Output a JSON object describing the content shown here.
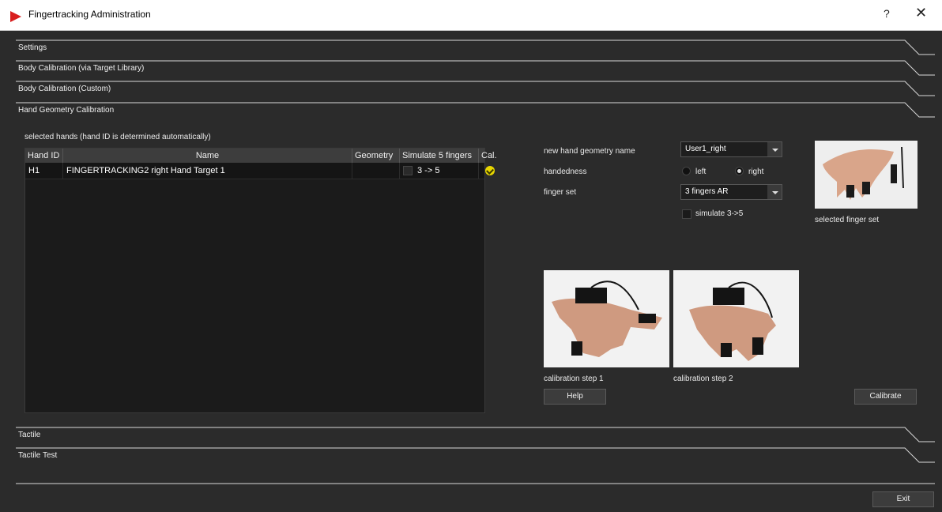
{
  "window": {
    "title": "Fingertracking Administration",
    "help_label": "?",
    "close_label": "✕"
  },
  "sections": {
    "settings": "Settings",
    "body_target": "Body Calibration (via Target Library)",
    "body_custom": "Body Calibration (Custom)",
    "hand_geometry": "Hand Geometry Calibration",
    "tactile": "Tactile",
    "tactile_test": "Tactile Test"
  },
  "hands": {
    "caption": "selected hands (hand ID is determined automatically)",
    "columns": [
      "Hand ID",
      "Name",
      "Geometry",
      "Simulate 5 fingers",
      "Cal."
    ],
    "rows": [
      {
        "hand_id": "H1",
        "name": "FINGERTRACKING2 right Hand Target 1",
        "geometry": "",
        "simulate": "3 -> 5",
        "calibrated": true
      }
    ]
  },
  "form": {
    "geometry_name_label": "new hand geometry name",
    "geometry_name_value": "User1_right",
    "handedness_label": "handedness",
    "left_label": "left",
    "right_label": "right",
    "handedness_selected": "right",
    "finger_set_label": "finger set",
    "finger_set_value": "3 fingers AR",
    "simulate_label": "simulate 3->5",
    "simulate_checked": false
  },
  "images": {
    "finger_set_caption": "selected finger set",
    "step1_caption": "calibration step 1",
    "step2_caption": "calibration step 2"
  },
  "buttons": {
    "help": "Help",
    "calibrate": "Calibrate",
    "exit": "Exit"
  },
  "colors": {
    "background": "#2b2b2b",
    "table_bg": "#1b1b1b",
    "ok_yellow": "#e8d600",
    "logo_red": "#d81e1e"
  }
}
